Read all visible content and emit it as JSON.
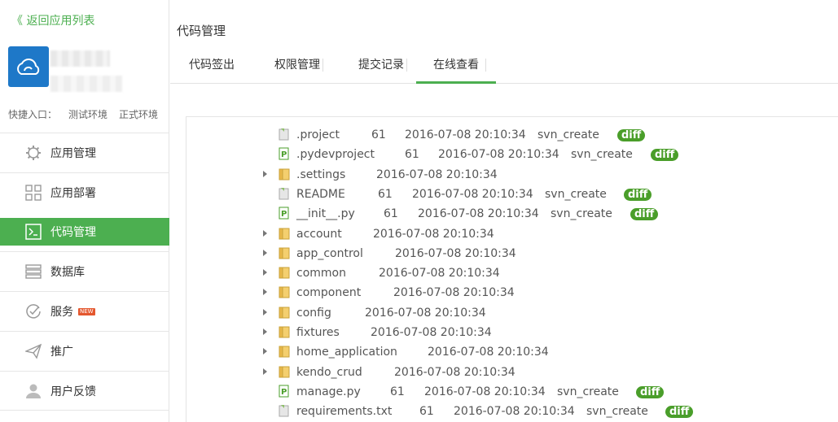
{
  "sidebar": {
    "back_label": "《 返回应用列表",
    "quick_label": "快捷入口：",
    "quick_links": [
      "测试环境",
      "正式环境"
    ],
    "menu": [
      {
        "label": "应用管理",
        "icon": "gear-icon"
      },
      {
        "label": "应用部署",
        "icon": "grid-icon"
      },
      {
        "label": "代码管理",
        "icon": "terminal-icon",
        "active": true
      },
      {
        "label": "数据库",
        "icon": "database-icon"
      },
      {
        "label": "服务",
        "icon": "check-circle-icon",
        "badge": "NEW"
      },
      {
        "label": "推广",
        "icon": "paper-plane-icon"
      },
      {
        "label": "用户反馈",
        "icon": "user-icon"
      }
    ]
  },
  "main": {
    "title": "代码管理",
    "tabs": [
      "代码签出",
      "权限管理",
      "提交记录",
      "在线查看"
    ],
    "active_tab": 3
  },
  "files": [
    {
      "name": ".project",
      "type": "file",
      "rev": "61",
      "date": "2016-07-08 20:10:34",
      "author": "svn_create",
      "diff": "diff"
    },
    {
      "name": ".pydevproject",
      "type": "py",
      "rev": "61",
      "date": "2016-07-08 20:10:34",
      "author": "svn_create",
      "diff": "diff"
    },
    {
      "name": ".settings",
      "type": "folder",
      "date": "2016-07-08 20:10:34"
    },
    {
      "name": "README",
      "type": "file",
      "rev": "61",
      "date": "2016-07-08 20:10:34",
      "author": "svn_create",
      "diff": "diff"
    },
    {
      "name": "__init__.py",
      "type": "py",
      "rev": "61",
      "date": "2016-07-08 20:10:34",
      "author": "svn_create",
      "diff": "diff"
    },
    {
      "name": "account",
      "type": "folder",
      "date": "2016-07-08 20:10:34"
    },
    {
      "name": "app_control",
      "type": "folder",
      "date": "2016-07-08 20:10:34"
    },
    {
      "name": "common",
      "type": "folder",
      "date": "2016-07-08 20:10:34"
    },
    {
      "name": "component",
      "type": "folder",
      "date": "2016-07-08 20:10:34"
    },
    {
      "name": "config",
      "type": "folder",
      "date": "2016-07-08 20:10:34"
    },
    {
      "name": "fixtures",
      "type": "folder",
      "date": "2016-07-08 20:10:34"
    },
    {
      "name": "home_application",
      "type": "folder",
      "date": "2016-07-08 20:10:34"
    },
    {
      "name": "kendo_crud",
      "type": "folder",
      "date": "2016-07-08 20:10:34"
    },
    {
      "name": "manage.py",
      "type": "py",
      "rev": "61",
      "date": "2016-07-08 20:10:34",
      "author": "svn_create",
      "diff": "diff"
    },
    {
      "name": "requirements.txt",
      "type": "file",
      "rev": "61",
      "date": "2016-07-08 20:10:34",
      "author": "svn_create",
      "diff": "diff"
    }
  ],
  "colors": {
    "accent": "#4caf50",
    "logo": "#1e78c8",
    "diff": "#4a9e2a"
  }
}
